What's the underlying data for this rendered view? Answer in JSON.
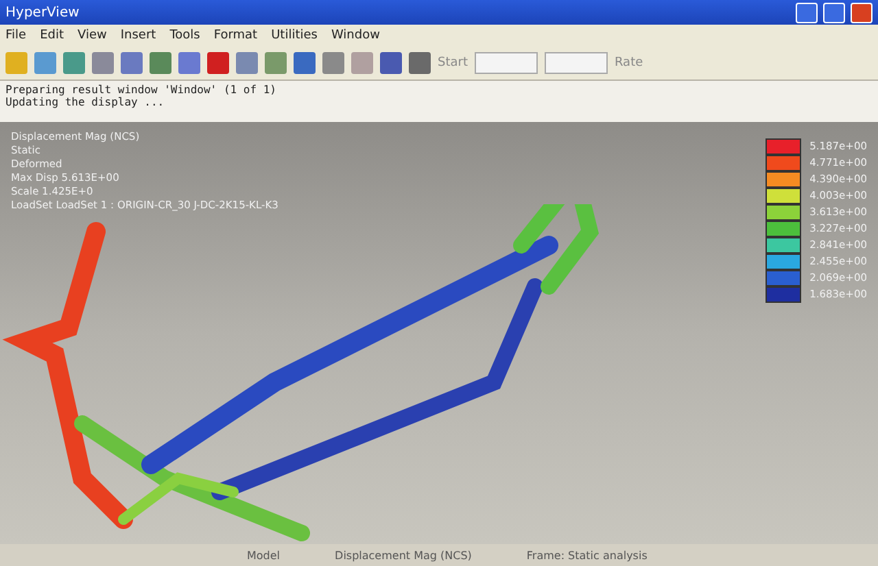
{
  "window": {
    "title": "HyperView"
  },
  "menu": [
    "File",
    "Edit",
    "View",
    "Insert",
    "Tools",
    "Format",
    "Utilities",
    "Window"
  ],
  "toolbar": {
    "start_label": "Start",
    "rate_label": "Rate"
  },
  "messages": [
    "Preparing result window 'Window' (1 of 1)",
    "Updating the display ..."
  ],
  "result_info": [
    "Displacement Mag (NCS)",
    "Static",
    "Deformed",
    "Max Disp 5.613E+00",
    "Scale 1.425E+0",
    "LoadSet LoadSet 1 : ORIGIN-CR_30 J-DC-2K15-KL-K3"
  ],
  "legend": [
    {
      "value": "5.187e+00",
      "color": "#e8202a"
    },
    {
      "value": "4.771e+00",
      "color": "#f04a1c"
    },
    {
      "value": "4.390e+00",
      "color": "#f58b22"
    },
    {
      "value": "4.003e+00",
      "color": "#cfe03a"
    },
    {
      "value": "3.613e+00",
      "color": "#8cd23a"
    },
    {
      "value": "3.227e+00",
      "color": "#4cbf3c"
    },
    {
      "value": "2.841e+00",
      "color": "#3cc7a0"
    },
    {
      "value": "2.455e+00",
      "color": "#2aa8e0"
    },
    {
      "value": "2.069e+00",
      "color": "#2a5fd0"
    },
    {
      "value": "1.683e+00",
      "color": "#1e2ea0"
    }
  ],
  "status_bar": [
    "Model",
    "Displacement Mag (NCS)",
    "Frame: Static analysis"
  ]
}
